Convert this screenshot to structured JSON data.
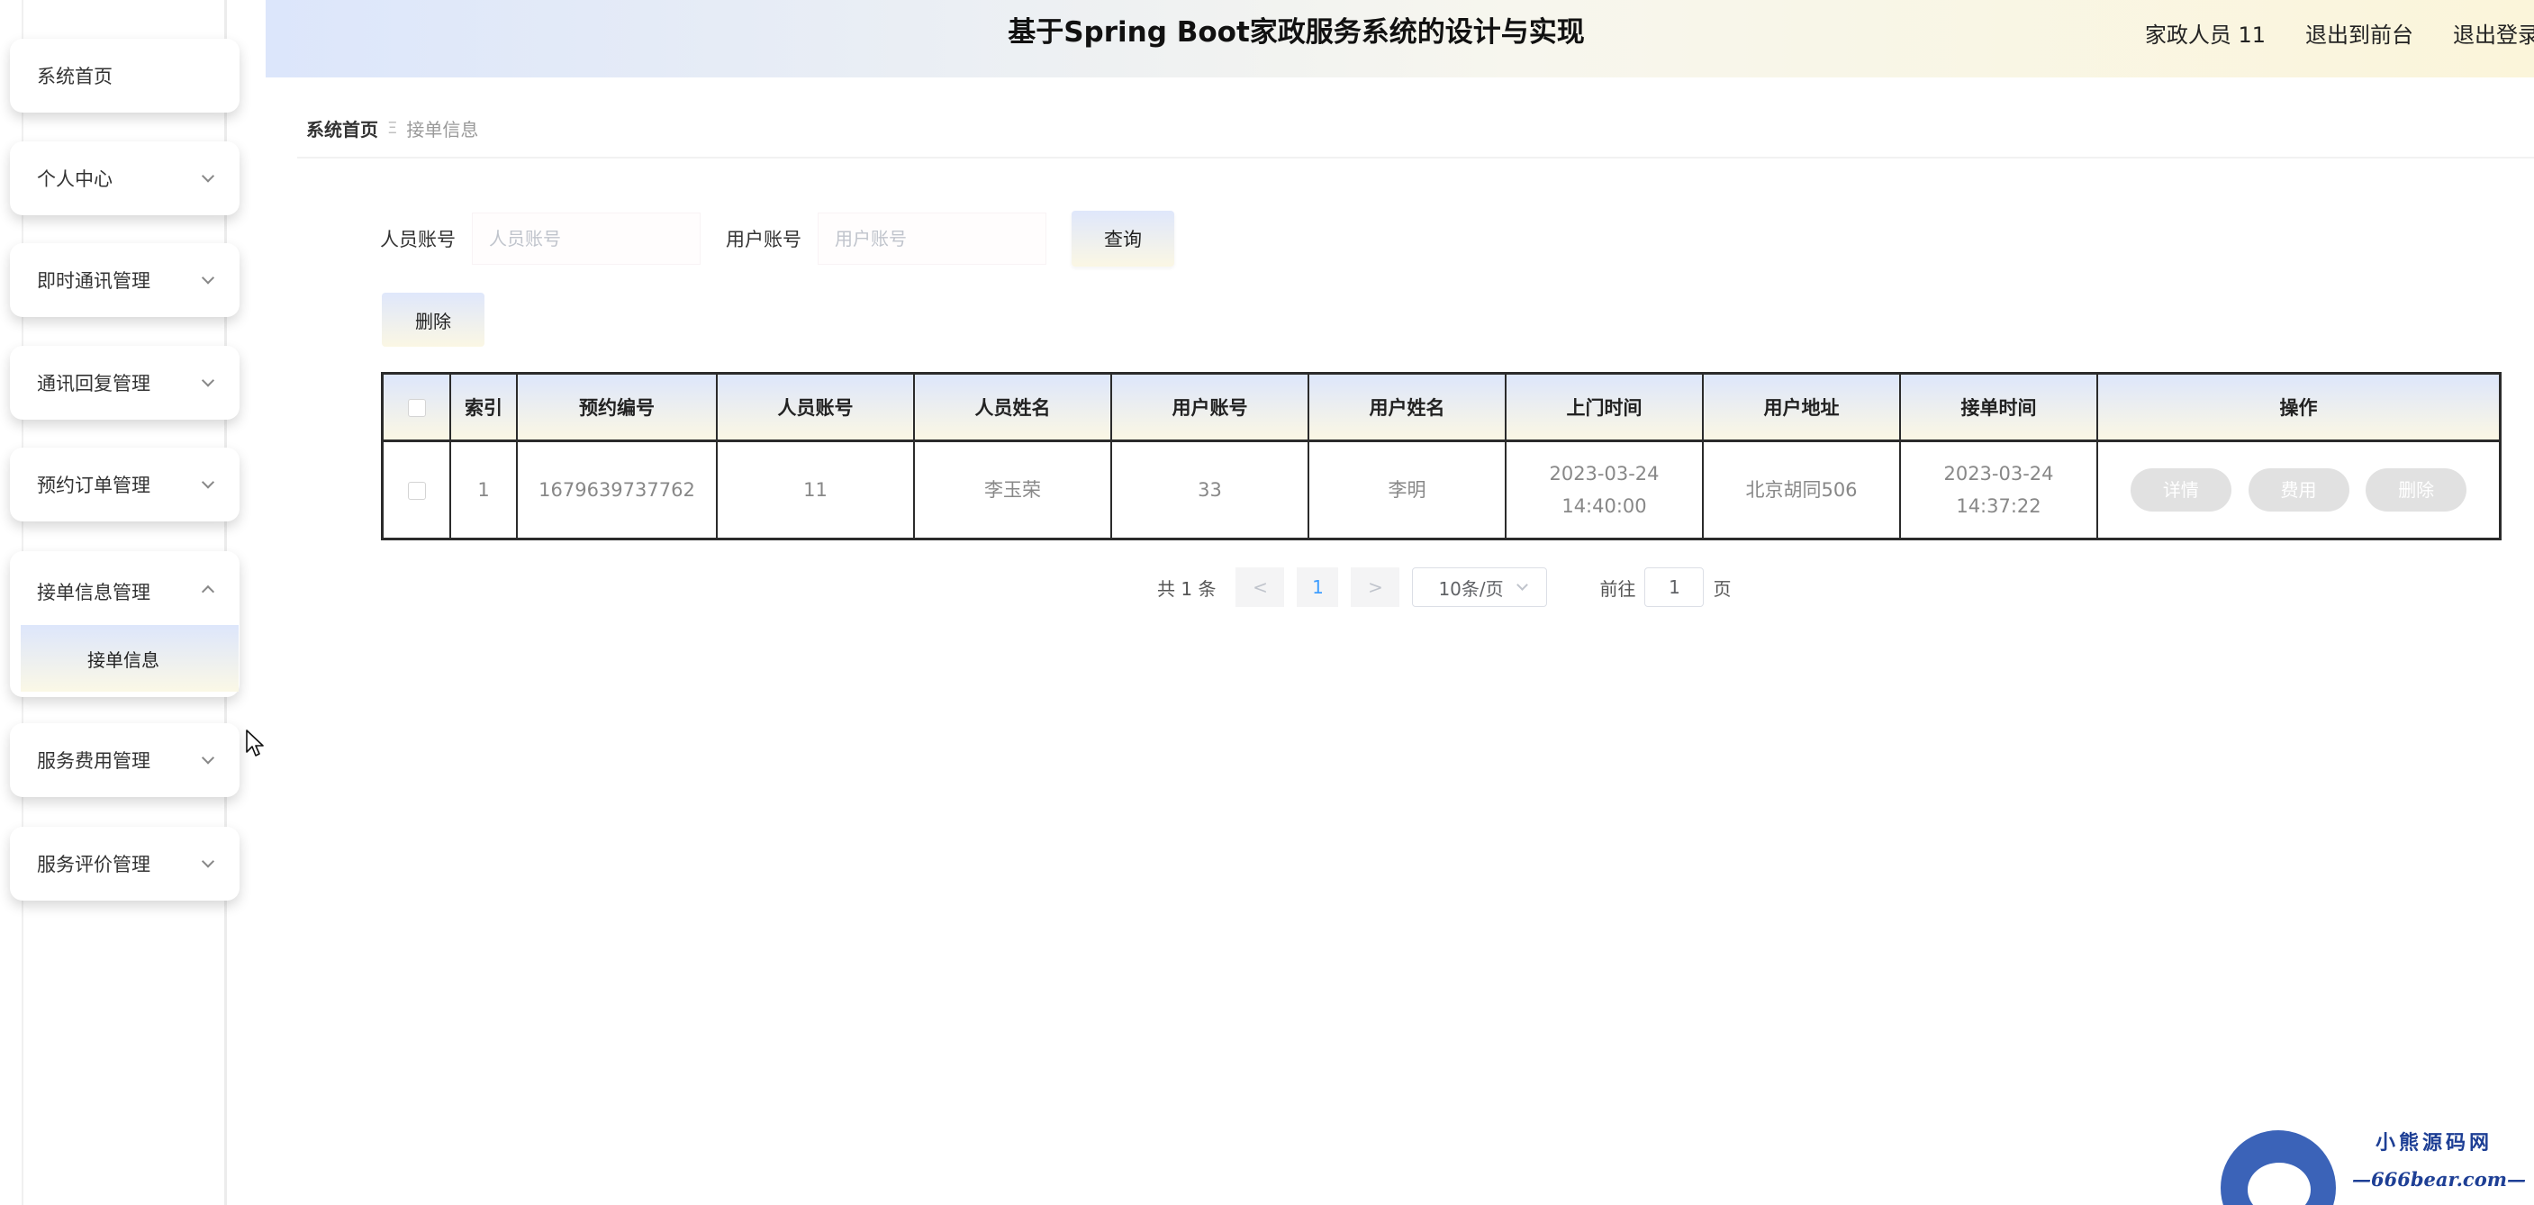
{
  "header": {
    "title": "基于Spring Boot家政服务系统的设计与实现",
    "user": "家政人员 11",
    "to_front": "退出到前台",
    "logout": "退出登录"
  },
  "sidebar": {
    "items": [
      {
        "label": "系统首页",
        "has_chevron": false
      },
      {
        "label": "个人中心",
        "has_chevron": true
      },
      {
        "label": "即时通讯管理",
        "has_chevron": true
      },
      {
        "label": "通讯回复管理",
        "has_chevron": true
      },
      {
        "label": "预约订单管理",
        "has_chevron": true
      },
      {
        "label": "接单信息管理",
        "has_chevron": true,
        "expanded": true,
        "children": [
          {
            "label": "接单信息"
          }
        ]
      },
      {
        "label": "服务费用管理",
        "has_chevron": true
      },
      {
        "label": "服务评价管理",
        "has_chevron": true
      }
    ]
  },
  "breadcrumb": {
    "home": "系统首页",
    "separator": "Ξ",
    "current": "接单信息"
  },
  "search": {
    "staff_label": "人员账号",
    "staff_placeholder": "人员账号",
    "user_label": "用户账号",
    "user_placeholder": "用户账号",
    "query_button": "查询"
  },
  "toolbar": {
    "delete_button": "删除"
  },
  "table": {
    "headers": [
      "",
      "索引",
      "预约编号",
      "人员账号",
      "人员姓名",
      "用户账号",
      "用户姓名",
      "上门时间",
      "用户地址",
      "接单时间",
      "操作"
    ],
    "rows": [
      {
        "index": "1",
        "order_no": "1679639737762",
        "staff_account": "11",
        "staff_name": "李玉荣",
        "user_account": "33",
        "user_name": "李明",
        "visit_time": "2023-03-24 14:40:00",
        "address": "北京胡同506",
        "accept_time": "2023-03-24 14:37:22",
        "actions": [
          "详情",
          "费用",
          "删除"
        ]
      }
    ]
  },
  "pagination": {
    "total": "共 1 条",
    "prev": "<",
    "current_page": "1",
    "next": ">",
    "page_size": "10条/页",
    "goto_prefix": "前往",
    "goto_value": "1",
    "goto_suffix": "页"
  },
  "watermark": {
    "title": "小熊源码网",
    "url": "—666bear.com—"
  },
  "colors": {
    "header_gradient_start": "#dce6fb",
    "header_gradient_end": "#fbf5da",
    "table_border": "#2b2b2b",
    "action_button": "#e1e1e1",
    "watermark_blue": "#1e3f95"
  }
}
